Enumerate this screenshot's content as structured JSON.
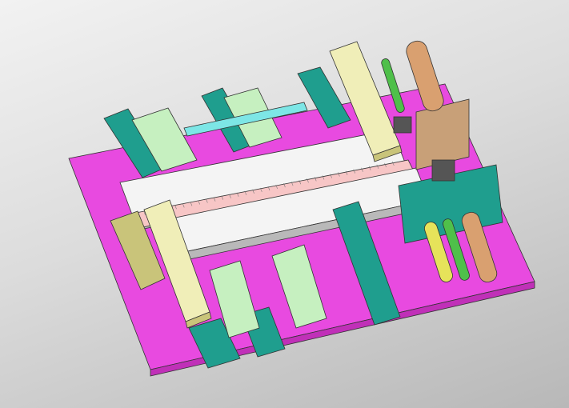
{
  "viewport": {
    "background_top": "#f2f2f2",
    "background_bottom": "#b8b8b8"
  },
  "model": {
    "colors": {
      "base_plate": "#e84ae0",
      "base_plate_shadow": "#c030b8",
      "teal_frame": "#1f9e8e",
      "teal_dark": "#137064",
      "light_green": "#c6f0c0",
      "cream": "#f0eeb8",
      "cream_dark": "#c9c47a",
      "rail_white": "#f4f4f4",
      "rail_gray": "#b9b9b9",
      "belt_pink": "#f7c6c6",
      "roller_green": "#4fc04a",
      "roller_yellow": "#e6e35a",
      "copper": "#d9a070",
      "cyan_pipe": "#7de6e6",
      "dark_gray": "#555555",
      "tan_panel": "#c8a078"
    }
  }
}
